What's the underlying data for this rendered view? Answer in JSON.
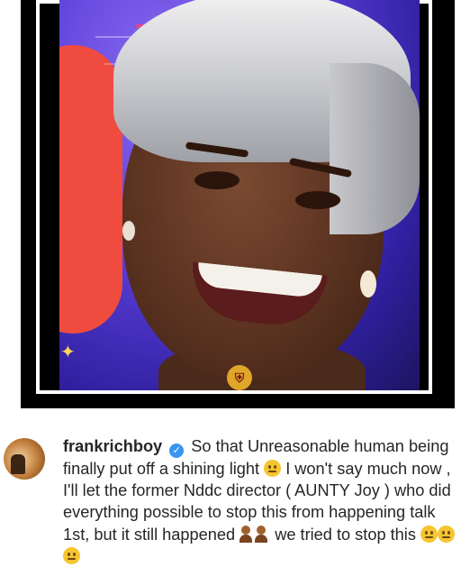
{
  "post": {
    "image_description_icon": "portrait-photo",
    "badge_icon": "shield-emblem-icon"
  },
  "comment": {
    "username": "frankrichboy",
    "verified_icon": "verified-badge-icon",
    "text_part1": "So that Unreasonable human being finally put off a shining light",
    "text_part2": "I won't say much now , I'll let the former Nddc director ( AUNTY Joy ) who did everything possible to stop this from happening talk 1st, but it still happened",
    "text_part3": "we tried to stop this",
    "emoji_icons": [
      "slightly-smiling-face-icon",
      "person-icon",
      "slightly-smiling-face-icon"
    ]
  },
  "colors": {
    "background": "#ffffff",
    "frame": "#000000",
    "verified": "#3897f0",
    "text": "#262626"
  }
}
